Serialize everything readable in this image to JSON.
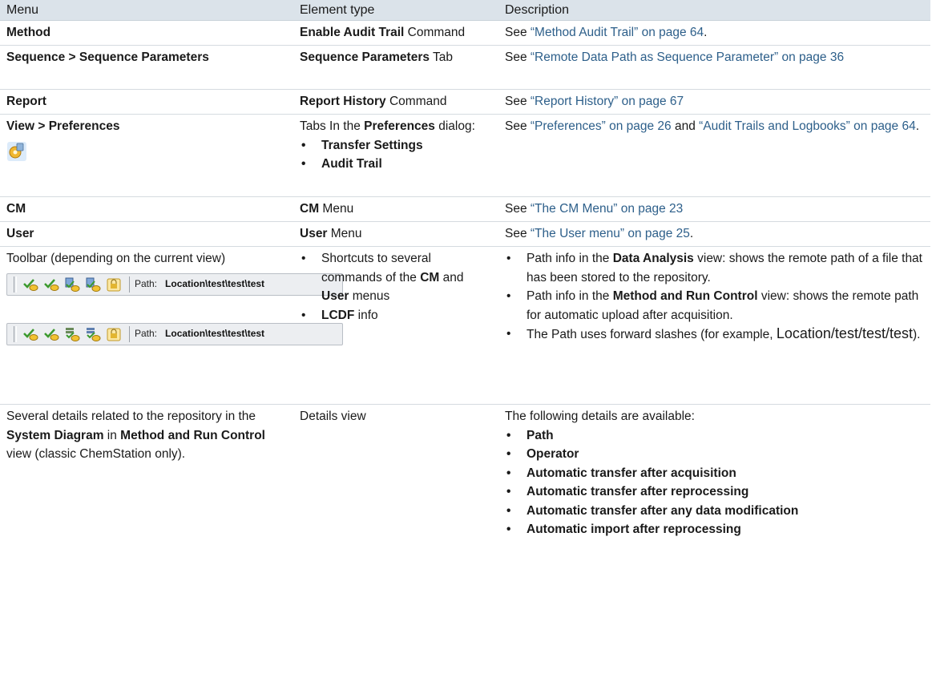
{
  "headers": [
    "Menu",
    "Element type",
    "Description"
  ],
  "rows": {
    "method": {
      "menu": "Method",
      "type_bold": "Enable Audit Trail",
      "type_rest": " Command",
      "desc_pre": "See ",
      "desc_link": "“Method Audit Trail” on page 64",
      "desc_post": "."
    },
    "sequence": {
      "menu": "Sequence > Sequence Parameters",
      "type_bold": "Sequence Parameters",
      "type_rest": " Tab",
      "desc_pre": "See ",
      "desc_link": "“Remote Data Path as Sequence Parameter” on page 36"
    },
    "report": {
      "menu": "Report",
      "type_bold": "Report History",
      "type_rest": " Command",
      "desc_pre": "See ",
      "desc_link": "“Report History” on page 67"
    },
    "view": {
      "menu": "View > Preferences",
      "icon": "preferences-icon",
      "type_pre": "Tabs In the ",
      "type_bold": "Preferences",
      "type_post": " dialog:",
      "tabs": [
        "Transfer Settings",
        "Audit Trail"
      ],
      "desc_pre": "See ",
      "desc_link1": "“Preferences” on page 26",
      "desc_mid": " and ",
      "desc_link2": "“Audit Trails and Logbooks” on page 64",
      "desc_post": "."
    },
    "cm": {
      "menu": "CM",
      "type_bold": "CM",
      "type_rest": " Menu",
      "desc_pre": "See ",
      "desc_link": "“The CM Menu” on page 23"
    },
    "user": {
      "menu": "User",
      "type_bold": "User",
      "type_rest": " Menu",
      "desc_pre": "See ",
      "desc_link": "“The User menu” on page 25",
      "desc_post": "."
    },
    "toolbar": {
      "menu": "Toolbar (depending on the current view)",
      "toolbar_path_label": "Path:",
      "toolbar_path_value": "Location\\test\\test\\test",
      "type_item1_pre": "Shortcuts to several commands of the ",
      "type_item1_b1": "CM",
      "type_item1_mid": " and ",
      "type_item1_b2": "User",
      "type_item1_post": " menus",
      "type_item2_b": "LCDF",
      "type_item2_post": " info",
      "desc1_pre": "Path info in the ",
      "desc1_b": "Data Analysis",
      "desc1_post": " view: shows the remote path of a file that has been stored to the repository.",
      "desc2_pre": "Path info in the ",
      "desc2_b": "Method and Run Control",
      "desc2_post": " view: shows the remote path for automatic upload after acquisition.",
      "desc3_pre": "The Path uses forward slashes (for example, ",
      "desc3_big": "Location/test/test/test",
      "desc3_post": ")."
    },
    "details": {
      "menu_pre": "Several details related to the repository in the ",
      "menu_b1": "System Diagram",
      "menu_mid": " in ",
      "menu_b2": "Method and Run Control",
      "menu_post": " view (classic ChemStation only).",
      "type": "Details view",
      "desc_intro": "The following details are available:",
      "items": [
        "Path",
        "Operator",
        "Automatic transfer after acquisition",
        "Automatic transfer after reprocessing",
        "Automatic transfer after any data modification",
        "Automatic import after reprocessing"
      ]
    }
  },
  "colors": {
    "header_bg": "#dbe3ea",
    "link": "#2d5f8a",
    "text": "#1a1a1a"
  }
}
